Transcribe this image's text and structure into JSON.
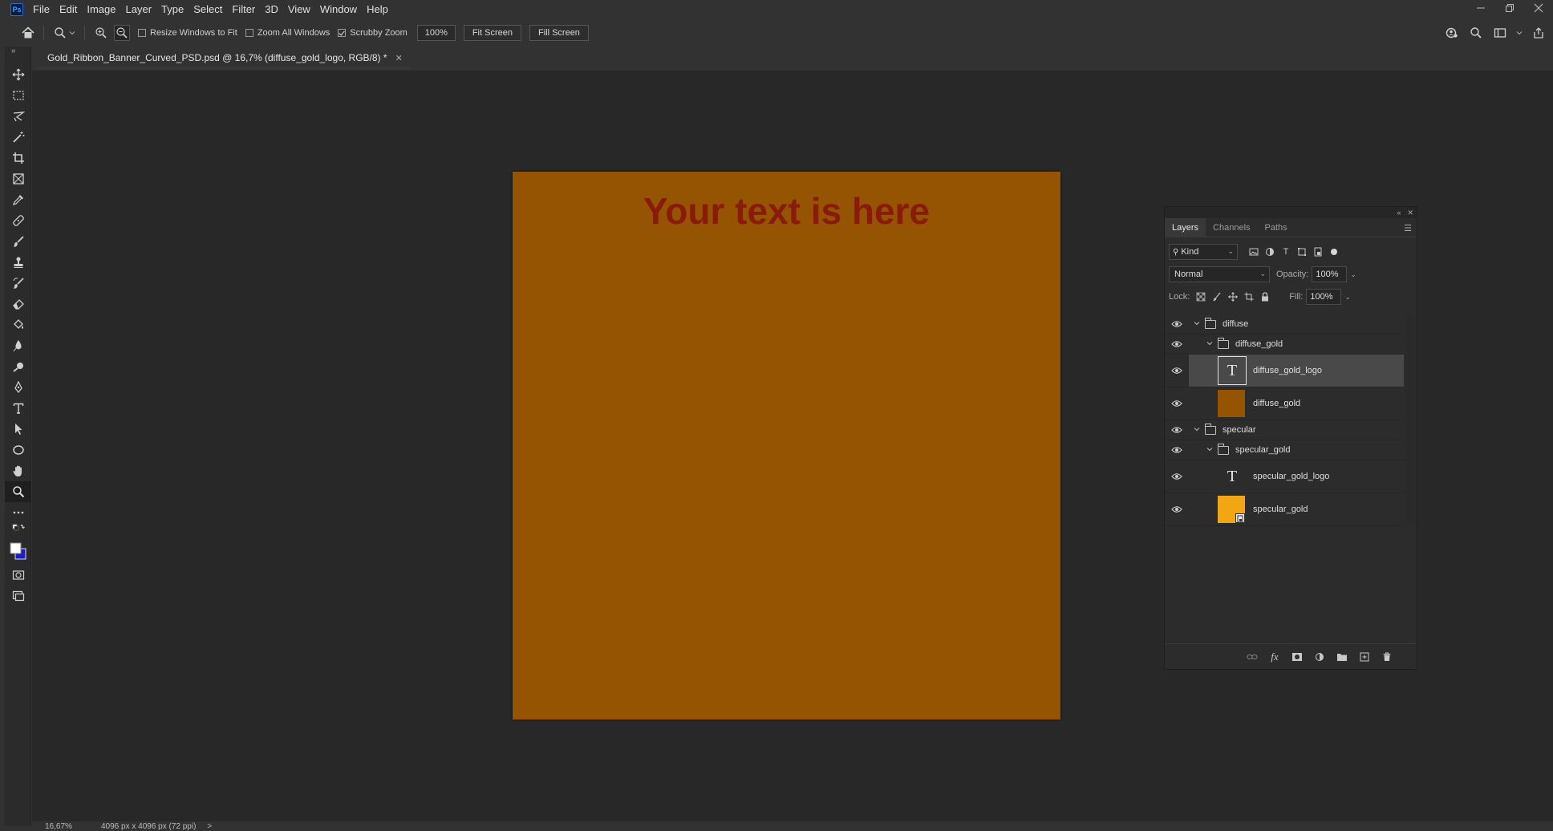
{
  "menubar": {
    "logo": "Ps",
    "items": [
      "File",
      "Edit",
      "Image",
      "Layer",
      "Type",
      "Select",
      "Filter",
      "3D",
      "View",
      "Window",
      "Help"
    ]
  },
  "options": {
    "resize_windows": "Resize Windows to Fit",
    "zoom_all": "Zoom All Windows",
    "scrubby_zoom": "Scrubby Zoom",
    "zoom_value": "100%",
    "fit_screen": "Fit Screen",
    "fill_screen": "Fill Screen"
  },
  "document": {
    "tab_title": "Gold_Ribbon_Banner_Curved_PSD.psd @ 16,7% (diffuse_gold_logo, RGB/8) *",
    "canvas_text": "Your text is here",
    "canvas_color": "#945401",
    "text_color": "#8a1a0c"
  },
  "status": {
    "zoom": "16,67%",
    "doc_info": "4096 px x 4096 px (72 ppi)",
    "arrow": ">"
  },
  "layers_panel": {
    "tabs": [
      "Layers",
      "Channels",
      "Paths"
    ],
    "kind": "Kind",
    "blend_mode": "Normal",
    "opacity_label": "Opacity:",
    "opacity_value": "100%",
    "lock_label": "Lock:",
    "fill_label": "Fill:",
    "fill_value": "100%",
    "layers": [
      {
        "name": "diffuse",
        "type": "group",
        "indent": 0
      },
      {
        "name": "diffuse_gold",
        "type": "group",
        "indent": 1
      },
      {
        "name": "diffuse_gold_logo",
        "type": "text",
        "selected": true
      },
      {
        "name": "diffuse_gold",
        "type": "fill",
        "color": "#945401"
      },
      {
        "name": "specular",
        "type": "group",
        "indent": 0
      },
      {
        "name": "specular_gold",
        "type": "group",
        "indent": 1
      },
      {
        "name": "specular_gold_logo",
        "type": "text"
      },
      {
        "name": "specular_gold",
        "type": "smart",
        "color": "#f2a614"
      }
    ]
  }
}
